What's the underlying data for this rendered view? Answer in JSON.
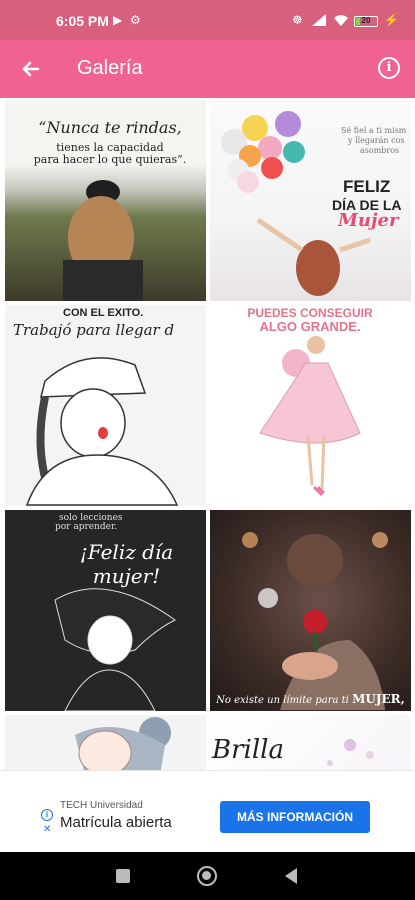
{
  "status_bar": {
    "time": "6:05 PM",
    "battery_level": "20",
    "battery_fraction": 0.2,
    "icons": [
      "play-icon",
      "settings-icon",
      "vibrate-icon",
      "signal-icon",
      "wifi-icon",
      "battery-icon",
      "charging-icon"
    ]
  },
  "app_bar": {
    "title": "Galería",
    "back_icon": "arrow-back-icon",
    "info_icon": "info-icon",
    "info_glyph": "i",
    "color": "#f06292"
  },
  "gallery": {
    "tiles": [
      {
        "id": "tile-1",
        "lines": [
          "“Nunca te rindas,",
          "tienes la capacidad",
          "para hacer lo que quieras”."
        ]
      },
      {
        "id": "tile-2",
        "lines": [
          "Sé fiel a ti mism",
          "y llegarán cos",
          "asombros",
          "FELIZ",
          "DÍA DE LA",
          "Mujer"
        ]
      },
      {
        "id": "tile-3",
        "lines": [
          "CON EL EXITO.",
          "Trabajó para llegar d"
        ]
      },
      {
        "id": "tile-4",
        "lines": [
          "PUEDES CONSEGUIR",
          "ALGO GRANDE."
        ]
      },
      {
        "id": "tile-5",
        "lines": [
          "solo lecciones",
          "por aprender.",
          "¡Feliz día mujer!"
        ]
      },
      {
        "id": "tile-6",
        "lines": [
          "No existe un límite para ti",
          "MUJER,"
        ]
      },
      {
        "id": "tile-7",
        "lines": []
      },
      {
        "id": "tile-8",
        "lines": [
          "Brilla"
        ]
      }
    ]
  },
  "ad": {
    "source": "TECH Universidad",
    "headline": "Matrícula abierta",
    "cta_label": "MÁS INFORMACIÓN",
    "info_glyph": "i",
    "close_glyph": "✕",
    "cta_color": "#1a73e8"
  },
  "nav_bar": {
    "buttons": [
      "recents-button",
      "home-button",
      "back-button"
    ]
  }
}
